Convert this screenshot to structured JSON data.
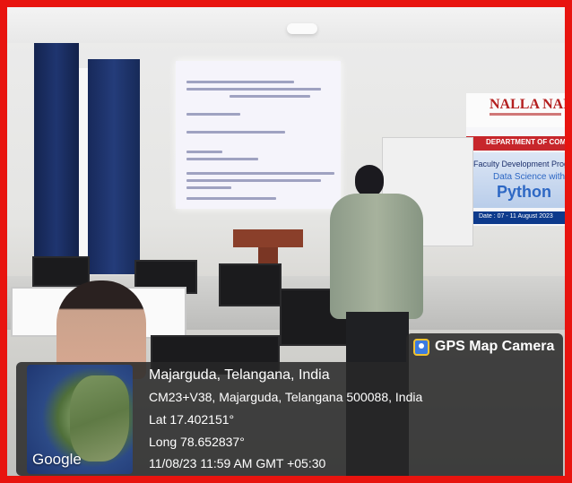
{
  "banner": {
    "title": "NALLA NAR",
    "department": "DEPARTMENT OF COMP",
    "program": "Faculty Development Prog",
    "subject_line": "Data Science with",
    "language": "Python",
    "date": "Date : 07 - 11 August 2023"
  },
  "overlay": {
    "app_name": "GPS Map Camera",
    "map_provider": "Google",
    "place": "Majarguda, Telangana, India",
    "address": "CM23+V38, Majarguda, Telangana 500088, India",
    "latitude": "Lat 17.402151°",
    "longitude": "Long 78.652837°",
    "datetime": "11/08/23 11:59 AM GMT +05:30"
  },
  "colors": {
    "frame_border": "#e8140f",
    "overlay_bg": "#282828",
    "banner_red": "#c7262b",
    "curtain_blue": "#1f3570"
  },
  "icons": {
    "gps_app": "map-pin-icon"
  }
}
